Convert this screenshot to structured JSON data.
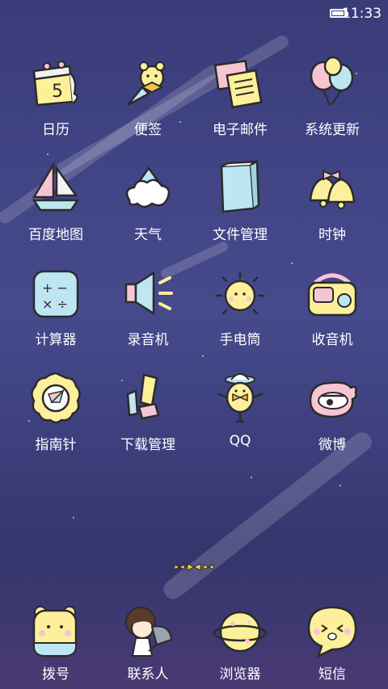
{
  "status_bar": {
    "time": "11:33",
    "battery_level": 1.0
  },
  "apps": [
    {
      "label": "日历",
      "icon": "calendar-icon"
    },
    {
      "label": "便签",
      "icon": "notes-icon"
    },
    {
      "label": "电子邮件",
      "icon": "email-icon"
    },
    {
      "label": "系统更新",
      "icon": "balloons-icon"
    },
    {
      "label": "百度地图",
      "icon": "sailboat-icon"
    },
    {
      "label": "天气",
      "icon": "cloud-icon"
    },
    {
      "label": "文件管理",
      "icon": "folder-icon"
    },
    {
      "label": "时钟",
      "icon": "bell-icon"
    },
    {
      "label": "计算器",
      "icon": "calculator-icon"
    },
    {
      "label": "录音机",
      "icon": "speaker-icon"
    },
    {
      "label": "手电筒",
      "icon": "sun-icon"
    },
    {
      "label": "收音机",
      "icon": "radio-icon"
    },
    {
      "label": "指南针",
      "icon": "compass-icon"
    },
    {
      "label": "下载管理",
      "icon": "download-icon"
    },
    {
      "label": "QQ",
      "icon": "qq-icon"
    },
    {
      "label": "微博",
      "icon": "weibo-icon"
    }
  ],
  "dock": [
    {
      "label": "拨号",
      "icon": "bear-phone-icon"
    },
    {
      "label": "联系人",
      "icon": "girl-contacts-icon"
    },
    {
      "label": "浏览器",
      "icon": "planet-icon"
    },
    {
      "label": "短信",
      "icon": "chat-bubble-icon"
    }
  ],
  "page_indicator": {
    "pages": 3,
    "current": 2
  },
  "calendar_day": "5",
  "colors": {
    "yellow": "#fdf09a",
    "pink": "#f7c5d2",
    "blue": "#bde6f2",
    "outline": "#2b2b2b"
  }
}
